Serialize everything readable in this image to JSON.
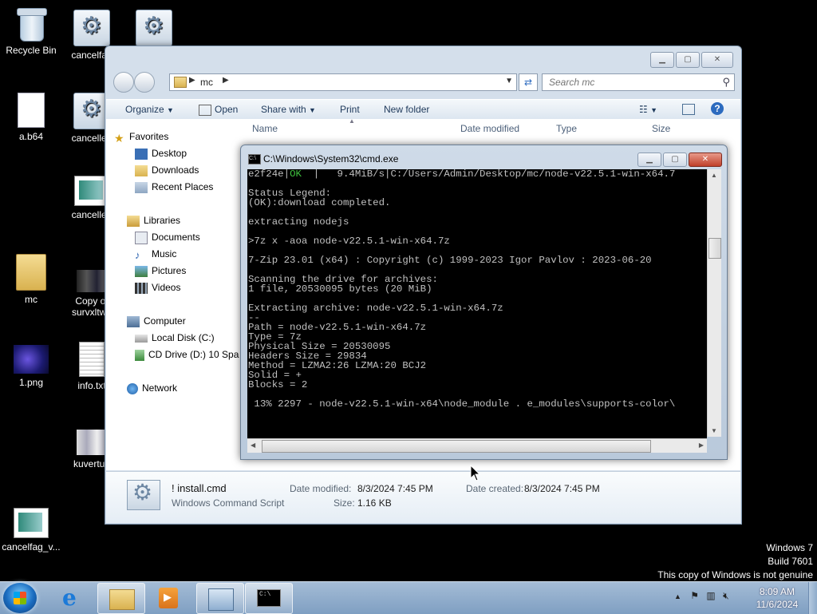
{
  "desktop": {
    "icons": [
      {
        "label": "Recycle Bin"
      },
      {
        "label": "cancelfag"
      },
      {
        "label": ""
      },
      {
        "label": "a.b64"
      },
      {
        "label": "cancelled"
      },
      {
        "label": "cancelled"
      },
      {
        "label": "mc"
      },
      {
        "label": "Copy of"
      },
      {
        "label": "survxltwa"
      },
      {
        "label": "1.png"
      },
      {
        "label": "info.txt"
      },
      {
        "label": "kuvertup"
      },
      {
        "label": "cancelfag_v..."
      }
    ]
  },
  "explorer": {
    "address_path": "mc",
    "search_placeholder": "Search mc",
    "toolbar": {
      "organize": "Organize",
      "open": "Open",
      "share_with": "Share with",
      "print": "Print",
      "new_folder": "New folder"
    },
    "nav": {
      "favorites": "Favorites",
      "desktop": "Desktop",
      "downloads": "Downloads",
      "recent_places": "Recent Places",
      "libraries": "Libraries",
      "documents": "Documents",
      "music": "Music",
      "pictures": "Pictures",
      "videos": "Videos",
      "computer": "Computer",
      "local_disk": "Local Disk (C:)",
      "cd_drive": "CD Drive (D:) 10 Spa",
      "network": "Network"
    },
    "columns": {
      "name": "Name",
      "date_modified": "Date modified",
      "type": "Type",
      "size": "Size"
    },
    "details": {
      "file_name": "! install.cmd",
      "file_type": "Windows Command Script",
      "date_modified_label": "Date modified:",
      "date_modified_value": "8/3/2024 7:45 PM",
      "size_label": "Size:",
      "size_value": "1.16 KB",
      "date_created_label": "Date created:",
      "date_created_value": "8/3/2024 7:45 PM"
    }
  },
  "cmd": {
    "title": "C:\\Windows\\System32\\cmd.exe",
    "icon_text": "C:\\",
    "lines": [
      {
        "pre": "e2f24e|",
        "ok": "OK",
        "post": "  |   9.4MiB/s|C:/Users/Admin/Desktop/mc/node-v22.5.1-win-x64.7"
      },
      {
        "pre": "",
        "ok": "",
        "post": ""
      },
      {
        "pre": "Status Legend:",
        "ok": "",
        "post": ""
      },
      {
        "pre": "(OK):download completed.",
        "ok": "",
        "post": ""
      },
      {
        "pre": "",
        "ok": "",
        "post": ""
      },
      {
        "pre": "extracting nodejs",
        "ok": "",
        "post": ""
      },
      {
        "pre": "",
        "ok": "",
        "post": ""
      },
      {
        "pre": ">7z x -aoa node-v22.5.1-win-x64.7z",
        "ok": "",
        "post": ""
      },
      {
        "pre": "",
        "ok": "",
        "post": ""
      },
      {
        "pre": "7-Zip 23.01 (x64) : Copyright (c) 1999-2023 Igor Pavlov : 2023-06-20",
        "ok": "",
        "post": ""
      },
      {
        "pre": "",
        "ok": "",
        "post": ""
      },
      {
        "pre": "Scanning the drive for archives:",
        "ok": "",
        "post": ""
      },
      {
        "pre": "1 file, 20530095 bytes (20 MiB)",
        "ok": "",
        "post": ""
      },
      {
        "pre": "",
        "ok": "",
        "post": ""
      },
      {
        "pre": "Extracting archive: node-v22.5.1-win-x64.7z",
        "ok": "",
        "post": ""
      },
      {
        "pre": "--",
        "ok": "",
        "post": ""
      },
      {
        "pre": "Path = node-v22.5.1-win-x64.7z",
        "ok": "",
        "post": ""
      },
      {
        "pre": "Type = 7z",
        "ok": "",
        "post": ""
      },
      {
        "pre": "Physical Size = 20530095",
        "ok": "",
        "post": ""
      },
      {
        "pre": "Headers Size = 29834",
        "ok": "",
        "post": ""
      },
      {
        "pre": "Method = LZMA2:26 LZMA:20 BCJ2",
        "ok": "",
        "post": ""
      },
      {
        "pre": "Solid = +",
        "ok": "",
        "post": ""
      },
      {
        "pre": "Blocks = 2",
        "ok": "",
        "post": ""
      },
      {
        "pre": "",
        "ok": "",
        "post": ""
      },
      {
        "pre": " 13% 2297 - node-v22.5.1-win-x64\\node_module . e_modules\\supports-color\\",
        "ok": "",
        "post": ""
      }
    ]
  },
  "watermark": {
    "line1": "Windows 7",
    "line2": "Build 7601",
    "line3": "This copy of Windows is not genuine"
  },
  "taskbar": {
    "time": "8:09 AM",
    "date": "11/6/2024",
    "cmd_icon_text": "C:\\"
  }
}
